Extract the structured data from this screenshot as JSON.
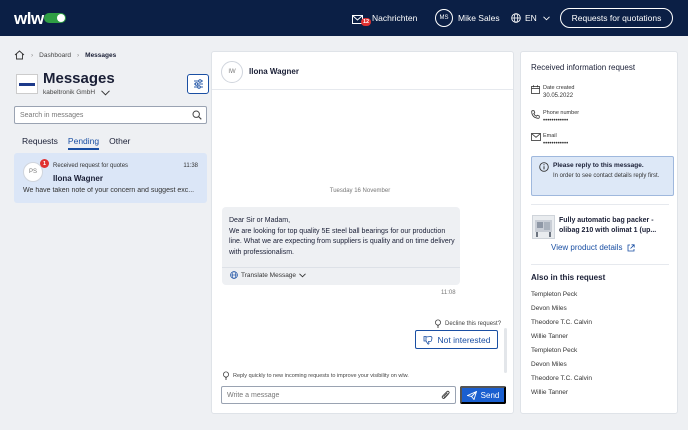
{
  "topbar": {
    "logo": "wlw",
    "messages_label": "Nachrichten",
    "messages_count": "12",
    "user_initials": "MS",
    "user_name": "Mike Sales",
    "language": "EN",
    "cta_label": "Requests for quotations"
  },
  "breadcrumb": {
    "home": "Dashboard",
    "current": "Messages"
  },
  "sidebar": {
    "title": "Messages",
    "company": "kabeltronik GmbH",
    "search_placeholder": "Search in messages",
    "tabs": [
      {
        "label": "Requests"
      },
      {
        "label": "Pending"
      },
      {
        "label": "Other"
      }
    ],
    "conversation": {
      "initials": "PS",
      "badge": "1",
      "subtitle": "Received request for quotes",
      "time": "11:38",
      "name": "Ilona Wagner",
      "preview": "We have taken note of your concern and suggest exc..."
    }
  },
  "chat": {
    "initials": "IW",
    "name": "Ilona Wagner",
    "date_label": "Tuesday 16 November",
    "message": "Dear Sir or Madam,\nWe are looking for top quality 5E steel ball bearings for our production line. What we are expecting from suppliers is quality and on time delivery with professionalism.",
    "translate_label": "Translate Message",
    "message_time": "11:08",
    "decline_question": "Decline this request?",
    "not_interested_label": "Not interested",
    "hint": "Reply quickly to new incoming requests to improve your visibility on wlw.",
    "input_placeholder": "Write a message",
    "send_label": "Send"
  },
  "info": {
    "title": "Received information request",
    "date_label": "Date created",
    "date_value": "30.05.2022",
    "phone_label": "Phone number",
    "phone_value": "••••••••••••",
    "email_label": "Email",
    "email_value": "••••••••••••",
    "notice_title": "Please reply to this message.",
    "notice_body": "In order to see contact details reply first.",
    "product_title_1": "Fully automatic bag packer -",
    "product_title_2": "olibag 210 with olimat 1 (up...",
    "product_link": "View product details",
    "also_title": "Also in this request",
    "also_list": [
      "Templeton Peck",
      "Devon Miles",
      "Theodore T.C. Calvin",
      "Willie Tanner",
      "Templeton Peck",
      "Devon Miles",
      "Theodore T.C. Calvin",
      "Willie Tanner"
    ]
  },
  "colors": {
    "navy": "#0b1f45",
    "accent_blue": "#1a4fa3",
    "send_blue": "#1a5fd0",
    "badge_red": "#e03131",
    "logo_green": "#2f9e44"
  }
}
